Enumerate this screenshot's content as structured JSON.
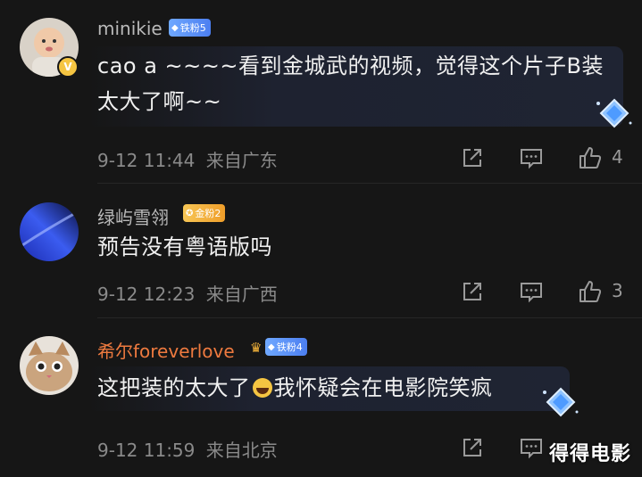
{
  "comments": [
    {
      "username": "minikie",
      "badge": "铁粉5",
      "text_line1": "cao a ~~~~看到金城武的视频，觉得这个片子B装",
      "text_line2": "太大了啊~~",
      "time": "9-12 11:44",
      "location": "来自广东",
      "likes": "4"
    },
    {
      "username": "绿屿雪翎",
      "badge": "金粉2",
      "text_line1": "预告没有粤语版吗",
      "time": "9-12 12:23",
      "location": "来自广西",
      "likes": "3"
    },
    {
      "username": "希尔foreverlove",
      "badge": "铁粉4",
      "text_before_emoji": "这把装的太大了",
      "text_after_emoji": "我怀疑会在电影院笑疯",
      "time": "9-12 11:59",
      "location": "来自北京",
      "likes": ""
    }
  ],
  "watermark": "得得电影",
  "colors": {
    "orange_name": "#ee7a3f",
    "blue_badge": "#5b8ff5",
    "gold_badge": "#f2ae3a"
  }
}
